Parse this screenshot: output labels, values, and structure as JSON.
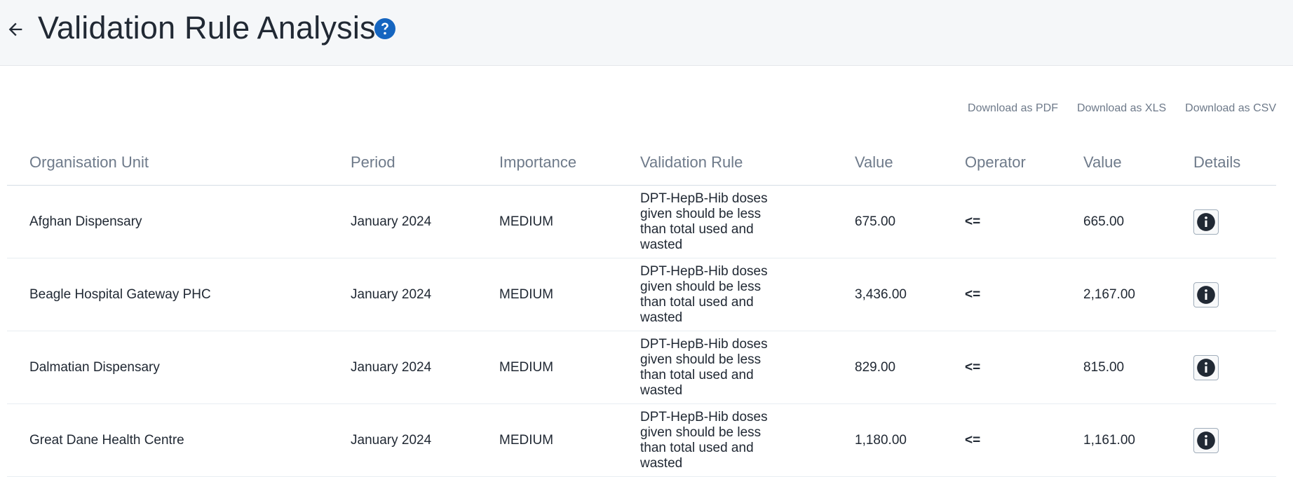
{
  "header": {
    "title": "Validation Rule Analysis"
  },
  "downloads": {
    "pdf": "Download as PDF",
    "xls": "Download as XLS",
    "csv": "Download as CSV"
  },
  "table": {
    "columns": [
      "Organisation Unit",
      "Period",
      "Importance",
      "Validation Rule",
      "Value",
      "Operator",
      "Value",
      "Details"
    ],
    "rows": [
      {
        "org": "Afghan Dispensary",
        "period": "January 2024",
        "importance": "MEDIUM",
        "rule": "DPT-HepB-Hib doses given should be less than total used and wasted",
        "value_left": "675.00",
        "operator": "<=",
        "value_right": "665.00"
      },
      {
        "org": "Beagle Hospital Gateway PHC",
        "period": "January 2024",
        "importance": "MEDIUM",
        "rule": "DPT-HepB-Hib doses given should be less than total used and wasted",
        "value_left": "3,436.00",
        "operator": "<=",
        "value_right": "2,167.00"
      },
      {
        "org": "Dalmatian Dispensary",
        "period": "January 2024",
        "importance": "MEDIUM",
        "rule": "DPT-HepB-Hib doses given should be less than total used and wasted",
        "value_left": "829.00",
        "operator": "<=",
        "value_right": "815.00"
      },
      {
        "org": "Great Dane Health Centre",
        "period": "January 2024",
        "importance": "MEDIUM",
        "rule": "DPT-HepB-Hib doses given should be less than total used and wasted",
        "value_left": "1,180.00",
        "operator": "<=",
        "value_right": "1,161.00"
      }
    ]
  },
  "icons": {
    "back": "arrow-left-icon",
    "help": "question-circle-icon",
    "details": "info-circle-icon"
  },
  "colors": {
    "header_bg": "#f5f7f9",
    "help_icon": "#1565c0",
    "info_icon": "#212934"
  }
}
